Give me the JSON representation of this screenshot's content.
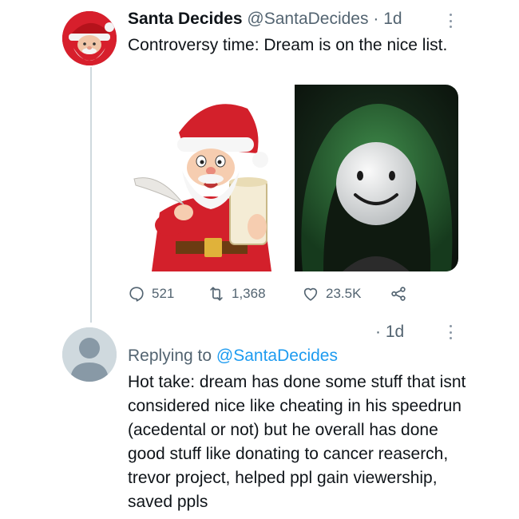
{
  "tweet": {
    "author_name": "Santa Decides",
    "author_handle": "@SantaDecides",
    "separator": "·",
    "time": "1d",
    "text": "Controversy time: Dream is on the nice list.",
    "media": [
      {
        "description": "santa-cartoon-image"
      },
      {
        "description": "dream-mask-hood-image"
      }
    ],
    "actions": {
      "replies": "521",
      "retweets": "1,368",
      "likes": "23.5K"
    }
  },
  "reply": {
    "separator": "·",
    "time": "1d",
    "replying_prefix": "Replying to",
    "replying_mention": "@SantaDecides",
    "text": "Hot take: dream has done some stuff that isnt considered nice like cheating in his speedrun (acedental or not) but he overall has done good stuff like donating to cancer reaserch, trevor project, helped ppl gain viewership, saved ppls"
  },
  "colors": {
    "text": "#0f1419",
    "secondary": "#536471",
    "accent": "#1d9bf0",
    "thread_line": "#cfd9de"
  }
}
